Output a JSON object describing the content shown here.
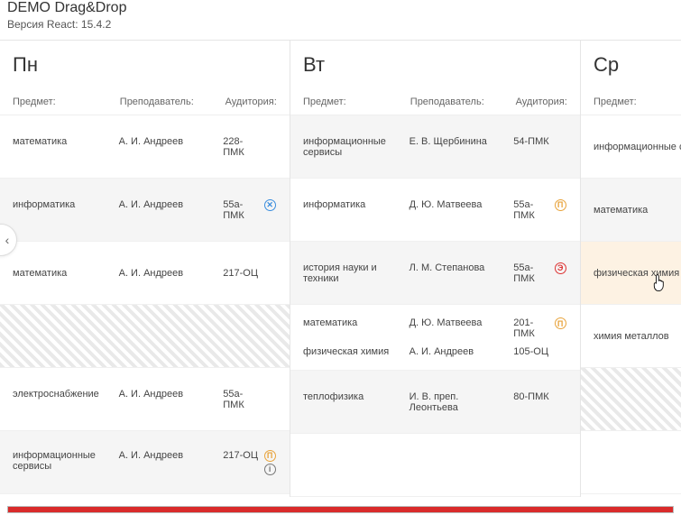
{
  "header": {
    "title": "DEMO Drag&Drop",
    "subtitle": "Версия React: 15.4.2"
  },
  "labels": {
    "subject": "Предмет:",
    "teacher": "Преподаватель:",
    "room": "Аудитория:"
  },
  "icons": {
    "blue_x": "✕",
    "orange_p": "П",
    "red_e": "Э",
    "gray_i": "i"
  },
  "days": [
    {
      "key": "mon",
      "name": "Пн",
      "slots": [
        {
          "style": "plain",
          "rows": [
            {
              "subject": "математика",
              "teacher": "А. И. Андреев",
              "room": "228-ПМК",
              "icon": null
            }
          ]
        },
        {
          "style": "shade",
          "rows": [
            {
              "subject": "информатика",
              "teacher": "А. И. Андреев",
              "room": "55a-ПМК",
              "icon": "blue_x"
            }
          ]
        },
        {
          "style": "plain",
          "rows": [
            {
              "subject": "математика",
              "teacher": "А. И. Андреев",
              "room": "217-ОЦ",
              "icon": null
            }
          ]
        },
        {
          "style": "hatch",
          "rows": []
        },
        {
          "style": "plain",
          "rows": [
            {
              "subject": "электроснабжение",
              "teacher": "А. И. Андреев",
              "room": "55a-ПМК",
              "icon": null
            }
          ]
        },
        {
          "style": "shade",
          "rows": [
            {
              "subject": "информационные сервисы",
              "teacher": "А. И. Андреев",
              "room": "217-ОЦ",
              "icon": "orange_p",
              "icon2": "gray_i"
            }
          ]
        }
      ]
    },
    {
      "key": "tue",
      "name": "Вт",
      "slots": [
        {
          "style": "shade",
          "rows": [
            {
              "subject": "информационные сервисы",
              "teacher": "Е. В. Щербинина",
              "room": "54-ПМК",
              "icon": null
            }
          ]
        },
        {
          "style": "plain",
          "rows": [
            {
              "subject": "информатика",
              "teacher": "Д. Ю. Матвеева",
              "room": "55a-ПМК",
              "icon": "orange_p"
            }
          ]
        },
        {
          "style": "shade",
          "rows": [
            {
              "subject": "история науки и техники",
              "teacher": "Л. М. Степанова",
              "room": "55a-ПМК",
              "icon": "red_e"
            }
          ]
        },
        {
          "style": "plain",
          "rows": [
            {
              "subject": "математика",
              "teacher": "Д. Ю. Матвеева",
              "room": "201-ПМК",
              "icon": "orange_p"
            },
            {
              "subject": "физическая химия",
              "teacher": "А. И. Андреев",
              "room": "105-ОЦ",
              "icon": null
            }
          ]
        },
        {
          "style": "shade",
          "rows": [
            {
              "subject": "теплофизика",
              "teacher": "И. В. преп. Леонтьева",
              "room": "80-ПМК",
              "icon": null
            }
          ]
        },
        {
          "style": "plain",
          "rows": []
        }
      ]
    },
    {
      "key": "wed",
      "name": "Ср",
      "slots": [
        {
          "style": "plain",
          "rows": [
            {
              "subject": "информационные сервисы"
            }
          ]
        },
        {
          "style": "shade",
          "rows": [
            {
              "subject": "математика"
            }
          ]
        },
        {
          "style": "highlight",
          "rows": [
            {
              "subject": "физическая химия"
            }
          ]
        },
        {
          "style": "plain",
          "rows": [
            {
              "subject": "химия металлов"
            }
          ]
        },
        {
          "style": "hatch",
          "rows": []
        },
        {
          "style": "plain",
          "rows": []
        }
      ]
    }
  ]
}
